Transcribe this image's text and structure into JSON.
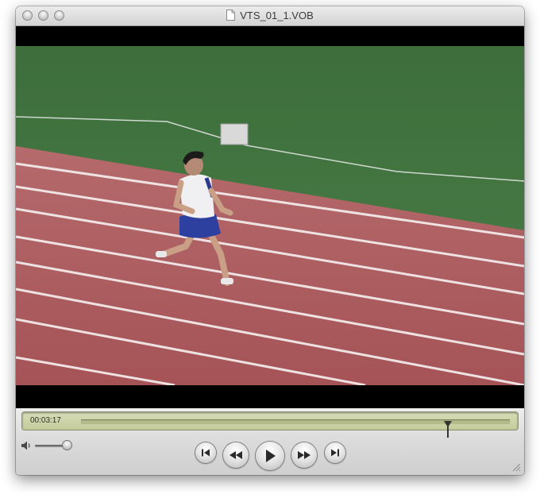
{
  "window": {
    "title": "VTS_01_1.VOB"
  },
  "player": {
    "current_time": "00:03:17",
    "progress_fraction": 0.855,
    "volume_fraction": 1.0
  },
  "controls": {
    "skip_back": "skip-to-start-icon",
    "rewind": "rewind-icon",
    "play": "play-icon",
    "fast_forward": "fast-forward-icon",
    "skip_forward": "skip-to-end-icon"
  }
}
